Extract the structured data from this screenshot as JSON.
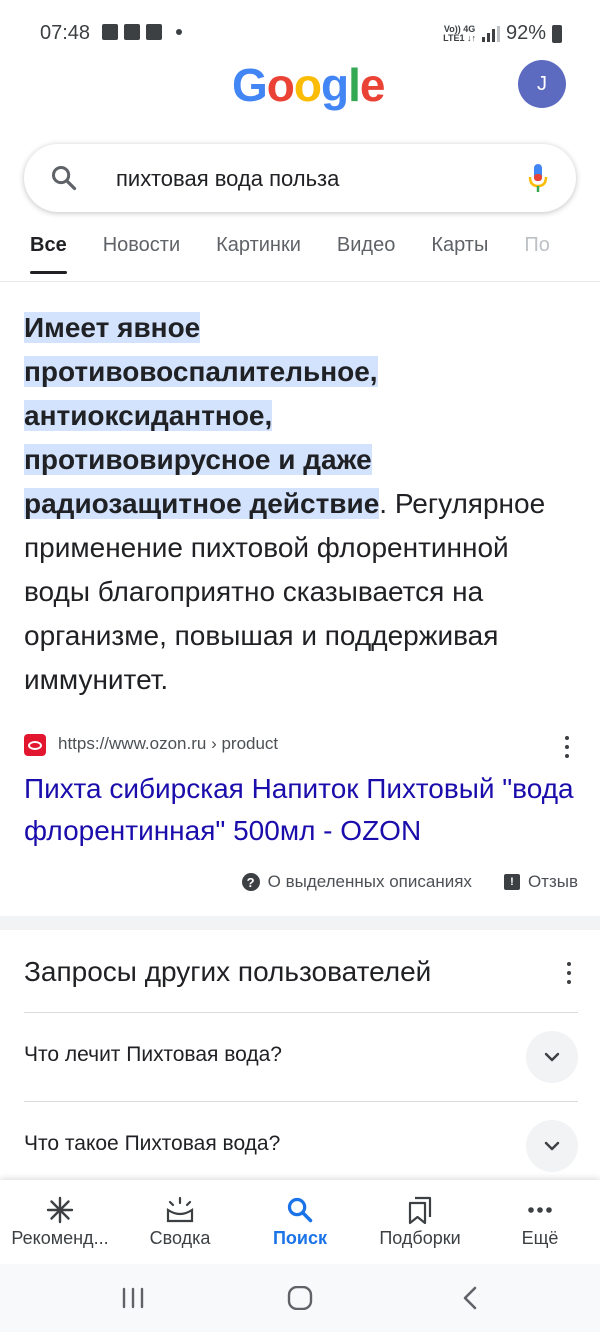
{
  "status_bar": {
    "time": "07:48",
    "net_top": "Vo)) 4G",
    "net_bottom": "LTE1 ↓↑",
    "battery": "92%"
  },
  "header": {
    "logo": [
      "G",
      "o",
      "o",
      "g",
      "l",
      "e"
    ],
    "avatar_letter": "J"
  },
  "search": {
    "query": "пихтовая вода польза"
  },
  "tabs": [
    {
      "label": "Все"
    },
    {
      "label": "Новости"
    },
    {
      "label": "Картинки"
    },
    {
      "label": "Видео"
    },
    {
      "label": "Карты"
    },
    {
      "label": "По"
    }
  ],
  "snippet": {
    "highlight_lines": [
      "Имеет явное",
      "противовоспалительное,",
      "антиоксидантное,",
      "противовирусное и даже",
      "радиозащитное действие"
    ],
    "period": ".",
    "rest": "Регулярное применение пихтовой флорентинной воды благоприятно сказывается на организме, повышая и поддерживая иммунитет."
  },
  "source": {
    "url": "https://www.ozon.ru › product",
    "link_title": "Пихта сибирская Напиток Пихтовый \"вода флорентинная\" 500мл - OZON"
  },
  "about": {
    "about_label": "О выделенных описаниях",
    "feedback_label": "Отзыв"
  },
  "paa": {
    "title": "Запросы других пользователей",
    "questions": [
      "Что лечит Пихтовая вода?",
      "Что такое Пихтовая вода?"
    ]
  },
  "bottom_nav": [
    {
      "label": "Рекоменд...",
      "icon": "asterisk-icon"
    },
    {
      "label": "Сводка",
      "icon": "briefing-icon"
    },
    {
      "label": "Поиск",
      "icon": "search-icon"
    },
    {
      "label": "Подборки",
      "icon": "collections-icon"
    },
    {
      "label": "Ещё",
      "icon": "more-icon"
    }
  ],
  "colors": {
    "accent": "#1a73e8",
    "link": "#1a0dab",
    "highlight": "#d3e3fd"
  }
}
